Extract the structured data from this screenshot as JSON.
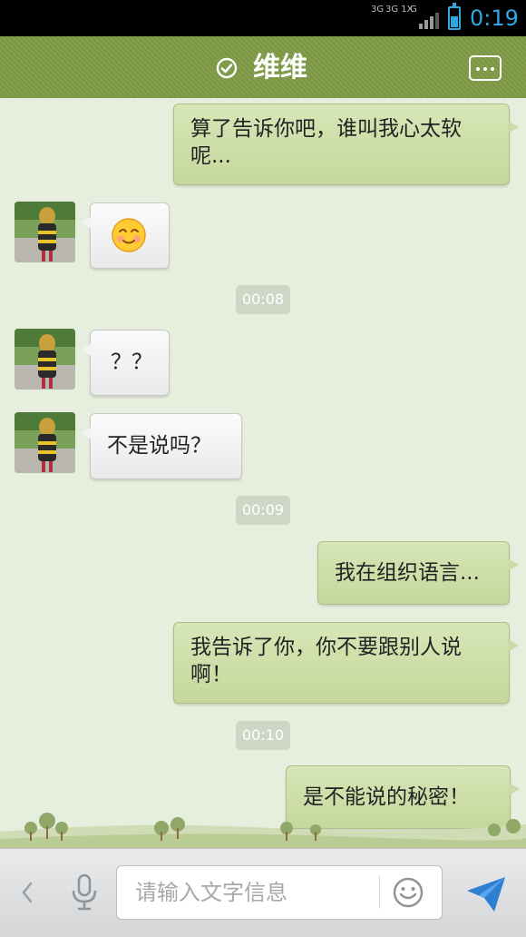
{
  "status_bar": {
    "network_left": "3G",
    "network_mid": "3G 1X",
    "network_right": "G",
    "time": "0:19"
  },
  "header": {
    "title": "维维"
  },
  "messages": [
    {
      "side": "right",
      "text": "算了告诉你吧，谁叫我心太软呢..."
    },
    {
      "side": "left",
      "emoji": "smiling-face"
    },
    {
      "time": "00:08"
    },
    {
      "side": "left",
      "text": "？？"
    },
    {
      "side": "left",
      "text": "不是说吗？"
    },
    {
      "time": "00:09"
    },
    {
      "side": "right",
      "text": "我在组织语言..."
    },
    {
      "side": "right",
      "text": "我告诉了你，你不要跟别人说啊！"
    },
    {
      "time": "00:10"
    },
    {
      "side": "right",
      "text": "是不能说的秘密！"
    }
  ],
  "input": {
    "placeholder": "请输入文字信息"
  },
  "colors": {
    "header_green": "#7e9a45",
    "status_blue": "#2ea8e0",
    "sent_bubble": "#c9da9f",
    "received_bubble": "#f2f2f2"
  },
  "icons": [
    "check-circle-icon",
    "more-menu-icon",
    "back-chevron-icon",
    "microphone-icon",
    "emoji-icon",
    "send-icon"
  ]
}
